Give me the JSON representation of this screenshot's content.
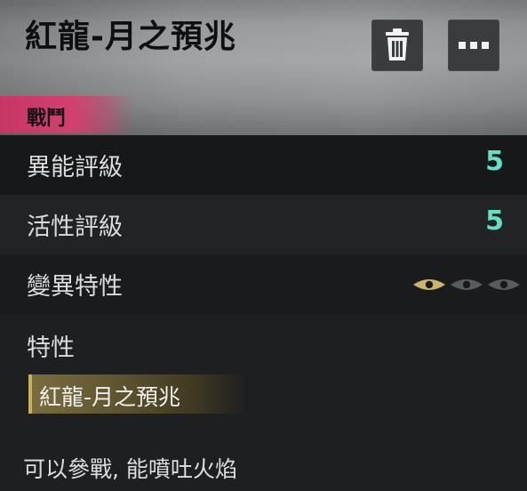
{
  "header": {
    "title": "紅龍-月之預兆",
    "category": "戰鬥"
  },
  "toolbar": {
    "delete_icon": "trash-icon",
    "more_icon": "more-dots-icon"
  },
  "stats": [
    {
      "label": "異能評級",
      "value": "5"
    },
    {
      "label": "活性評級",
      "value": "5"
    }
  ],
  "mutation": {
    "label": "變異特性",
    "level": 1,
    "max_level": 3,
    "icon": "eye-icon",
    "active_color": "#cbb56a",
    "inactive_color": "#5a5b5d"
  },
  "traits": {
    "label": "特性",
    "selected": "紅龍-月之預兆"
  },
  "description": "可以參戰, 能噴吐火焰",
  "colors": {
    "accent_value": "#62e0c4",
    "category_tag": "#c63766",
    "trait_chip": "#7a6c3e"
  }
}
